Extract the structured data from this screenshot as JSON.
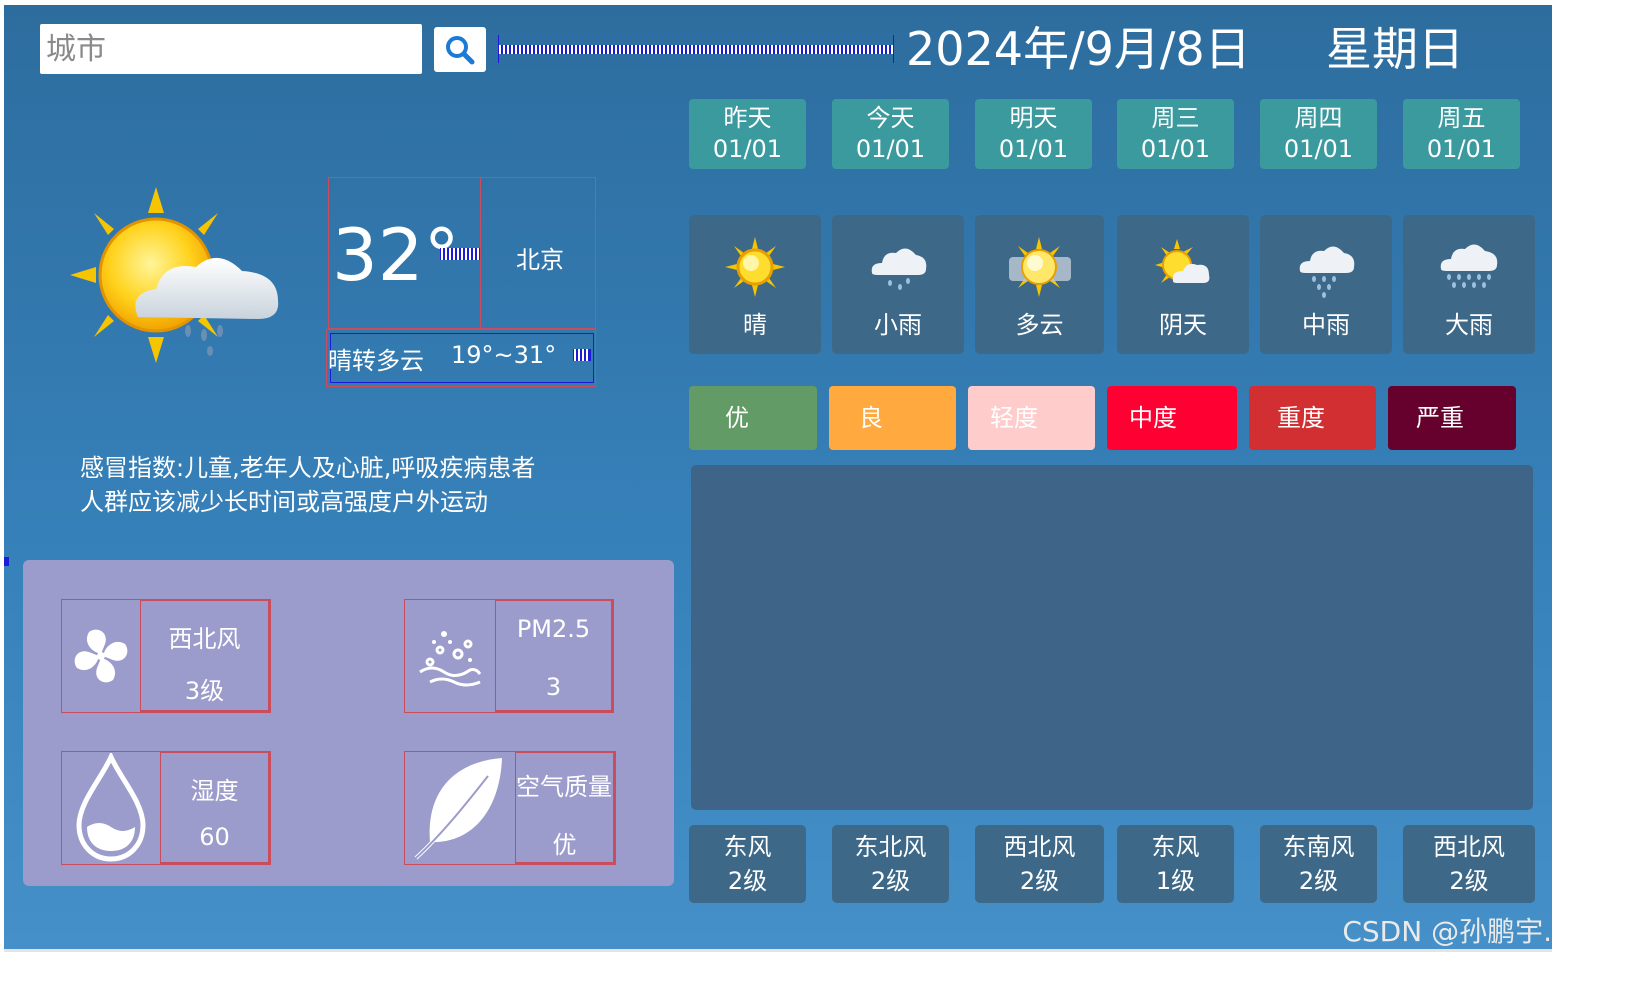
{
  "header": {
    "search_placeholder": "城市",
    "search_icon": "magnifier-icon",
    "date": "2024年/9月/8日",
    "weekday": "星期日"
  },
  "current": {
    "temperature": "32°",
    "city": "北京",
    "condition": "晴转多云",
    "range": "19°~31°",
    "icon": "sun-cloud-rain-icon",
    "flu_index_line1": "感冒指数:儿童,老年人及心脏,呼吸疾病患者",
    "flu_index_line2": "人群应该减少长时间或高强度户外运动"
  },
  "details": {
    "wind": {
      "label": "西北风",
      "value": "3级",
      "icon": "fan-icon"
    },
    "pm25": {
      "label": "PM2.5",
      "value": "3",
      "icon": "particles-icon"
    },
    "humidity": {
      "label": "湿度",
      "value": "60",
      "icon": "water-drop-icon"
    },
    "air_quality": {
      "label": "空气质量",
      "value": "优",
      "icon": "leaf-icon"
    }
  },
  "days": [
    {
      "name": "昨天",
      "date": "01/01"
    },
    {
      "name": "今天",
      "date": "01/01"
    },
    {
      "name": "明天",
      "date": "01/01"
    },
    {
      "name": "周三",
      "date": "01/01"
    },
    {
      "name": "周四",
      "date": "01/01"
    },
    {
      "name": "周五",
      "date": "01/01"
    }
  ],
  "forecast": [
    {
      "label": "晴",
      "icon": "sun-icon"
    },
    {
      "label": "小雨",
      "icon": "light-rain-cloud-icon"
    },
    {
      "label": "多云",
      "icon": "partly-cloudy-icon"
    },
    {
      "label": "阴天",
      "icon": "sun-cloud-icon"
    },
    {
      "label": "中雨",
      "icon": "moderate-rain-cloud-icon"
    },
    {
      "label": "大雨",
      "icon": "heavy-rain-cloud-icon"
    }
  ],
  "air_quality_levels": [
    {
      "label": "优",
      "color": "#629b66"
    },
    {
      "label": "良",
      "color": "#ffa93e"
    },
    {
      "label": "轻度",
      "color": "#ffcccc"
    },
    {
      "label": "中度",
      "color": "#ff0033"
    },
    {
      "label": "重度",
      "color": "#d22f32"
    },
    {
      "label": "严重",
      "color": "#66002d"
    }
  ],
  "winds": [
    {
      "direction": "东风",
      "level": "2级"
    },
    {
      "direction": "东北风",
      "level": "2级"
    },
    {
      "direction": "西北风",
      "level": "2级"
    },
    {
      "direction": "东风",
      "level": "1级"
    },
    {
      "direction": "东南风",
      "level": "2级"
    },
    {
      "direction": "西北风",
      "level": "2级"
    }
  ],
  "watermark": "CSDN @孙鹏宇."
}
